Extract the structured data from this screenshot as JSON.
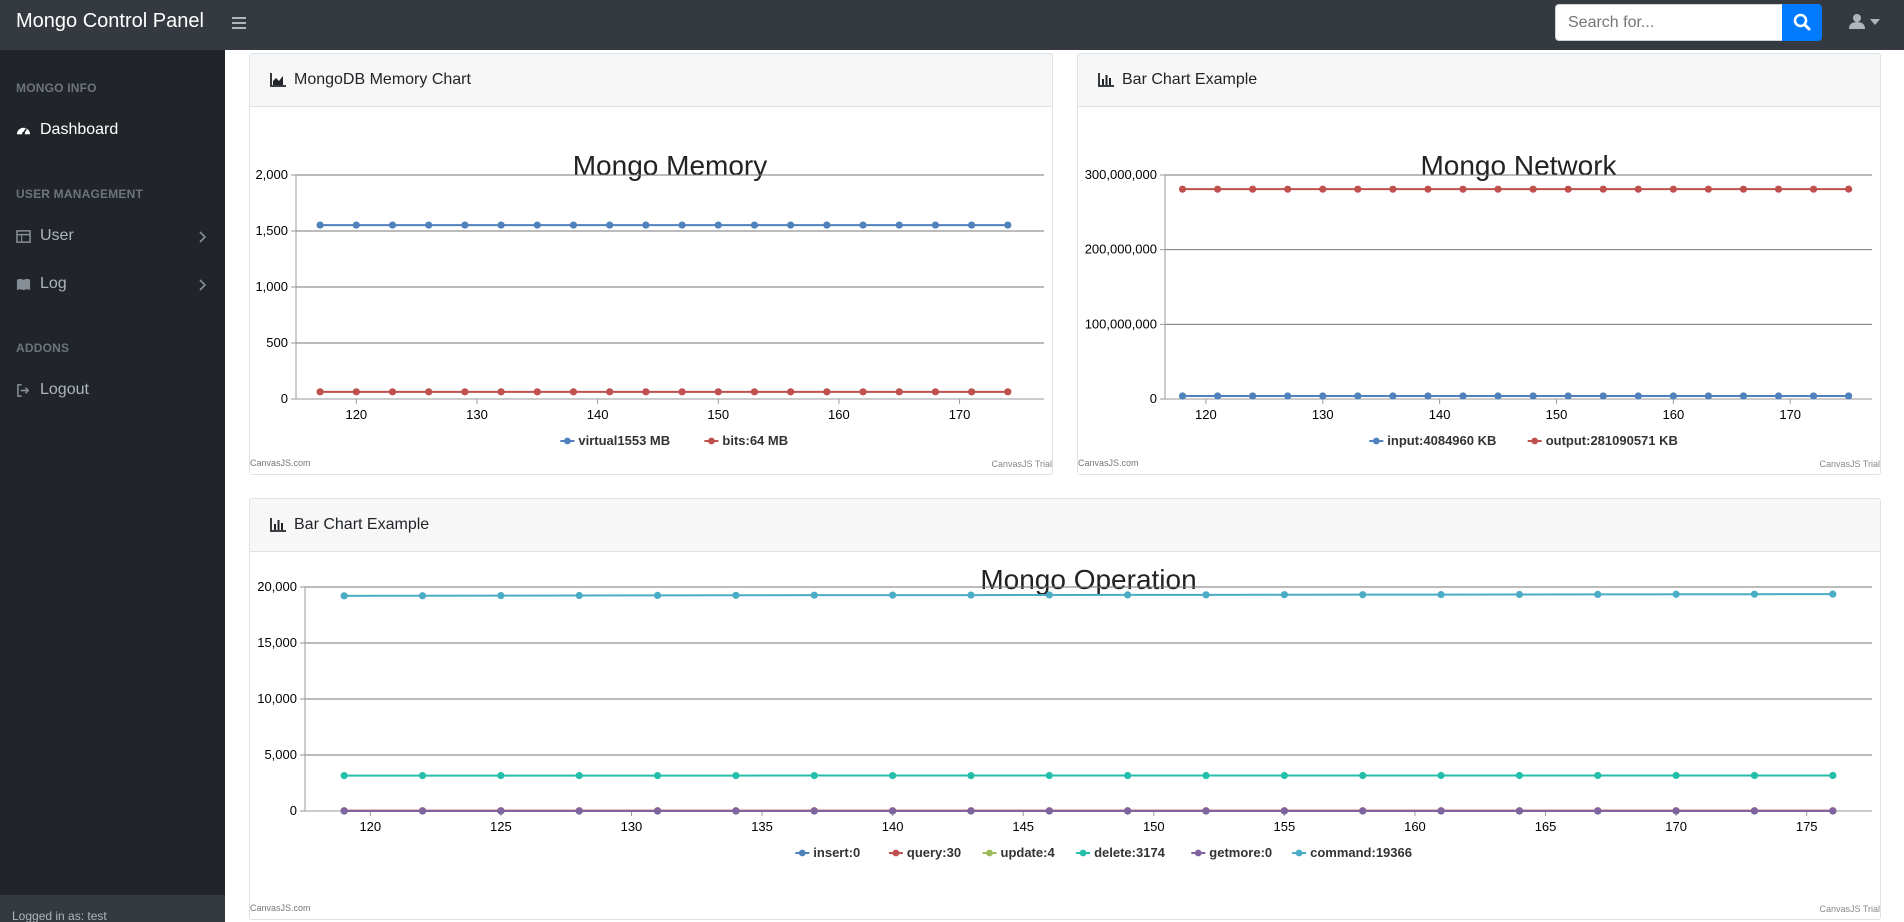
{
  "app": {
    "title": "Mongo Control Panel"
  },
  "search": {
    "placeholder": "Search for..."
  },
  "sidebar": {
    "sections": [
      {
        "heading": "MONGO INFO"
      },
      {
        "heading": "USER MANAGEMENT"
      },
      {
        "heading": "ADDONS"
      }
    ],
    "items": [
      {
        "label": "Dashboard",
        "icon": "tachometer-icon",
        "active": true
      },
      {
        "label": "User",
        "icon": "table-icon",
        "has_children": true
      },
      {
        "label": "Log",
        "icon": "book-icon",
        "has_children": true
      },
      {
        "label": "Logout",
        "icon": "sign-out-icon"
      }
    ],
    "footer": "Logged in as: test"
  },
  "cards": [
    {
      "header": "MongoDB Memory Chart",
      "icon": "area-chart-icon"
    },
    {
      "header": "Bar Chart Example",
      "icon": "bar-chart-icon"
    },
    {
      "header": "Bar Chart Example",
      "icon": "bar-chart-icon"
    }
  ],
  "credits": {
    "left": "CanvasJS.com",
    "right": "CanvasJS Trial"
  },
  "chart_data": [
    {
      "type": "line",
      "title": "Mongo Memory",
      "xlabel": "",
      "ylabel": "",
      "xlim": [
        115,
        177
      ],
      "ylim": [
        0,
        2000
      ],
      "yticks": [
        0,
        500,
        1000,
        1500,
        2000
      ],
      "xticks": [
        120,
        130,
        140,
        150,
        160,
        170
      ],
      "x": [
        117,
        120,
        123,
        126,
        129,
        132,
        135,
        138,
        141,
        144,
        147,
        150,
        153,
        156,
        159,
        162,
        165,
        168,
        171,
        174
      ],
      "series": [
        {
          "name": "virtual1553  MB",
          "color": "#4f81bc",
          "values": [
            1553,
            1553,
            1553,
            1553,
            1553,
            1553,
            1553,
            1553,
            1553,
            1553,
            1553,
            1553,
            1553,
            1553,
            1553,
            1553,
            1553,
            1553,
            1553,
            1553
          ]
        },
        {
          "name": "bits:64  MB",
          "color": "#c0504e",
          "values": [
            64,
            64,
            64,
            64,
            64,
            64,
            64,
            64,
            64,
            64,
            64,
            64,
            64,
            64,
            64,
            64,
            64,
            64,
            64,
            64
          ]
        }
      ],
      "grid": true,
      "legend": "bottom"
    },
    {
      "type": "line",
      "title": "Mongo  Network",
      "xlabel": "",
      "ylabel": "",
      "xlim": [
        116.5,
        177
      ],
      "ylim": [
        0,
        300000000
      ],
      "yticks": [
        0,
        100000000,
        200000000,
        300000000
      ],
      "xticks": [
        120,
        130,
        140,
        150,
        160,
        170
      ],
      "x": [
        118,
        121,
        124,
        127,
        130,
        133,
        136,
        139,
        142,
        145,
        148,
        151,
        154,
        157,
        160,
        163,
        166,
        169,
        172,
        175
      ],
      "series": [
        {
          "name": "input:4084960  KB",
          "color": "#4f81bc",
          "values": [
            4084960,
            4084960,
            4084960,
            4084960,
            4084960,
            4084960,
            4084960,
            4084960,
            4084960,
            4084960,
            4084960,
            4084960,
            4084960,
            4084960,
            4084960,
            4084960,
            4084960,
            4084960,
            4084960,
            4084960
          ]
        },
        {
          "name": "output:281090571  KB",
          "color": "#c0504e",
          "values": [
            281000000,
            281000000,
            281000000,
            281000000,
            281000000,
            281000000,
            281000000,
            281000000,
            281000000,
            281000000,
            281000000,
            281000000,
            281000000,
            281000000,
            281000000,
            281000000,
            281000000,
            281000000,
            281000000,
            281090571
          ]
        }
      ],
      "grid": true,
      "legend": "bottom"
    },
    {
      "type": "line",
      "title": "Mongo  Operation",
      "xlabel": "",
      "ylabel": "",
      "xlim": [
        117.5,
        177.5
      ],
      "ylim": [
        0,
        20000
      ],
      "yticks": [
        0,
        5000,
        10000,
        15000,
        20000
      ],
      "xticks": [
        120,
        125,
        130,
        135,
        140,
        145,
        150,
        155,
        160,
        165,
        170,
        175
      ],
      "x": [
        119,
        122,
        125,
        128,
        131,
        134,
        137,
        140,
        143,
        146,
        149,
        152,
        155,
        158,
        161,
        164,
        167,
        170,
        173,
        176
      ],
      "series": [
        {
          "name": "insert:0",
          "color": "#4f81bc",
          "values": [
            0,
            0,
            0,
            0,
            0,
            0,
            0,
            0,
            0,
            0,
            0,
            0,
            0,
            0,
            0,
            0,
            0,
            0,
            0,
            0
          ]
        },
        {
          "name": "query:30",
          "color": "#c0504e",
          "values": [
            30,
            30,
            30,
            30,
            30,
            30,
            30,
            30,
            30,
            30,
            30,
            30,
            30,
            30,
            30,
            30,
            30,
            30,
            30,
            30
          ]
        },
        {
          "name": "update:4",
          "color": "#9bbb58",
          "values": [
            4,
            4,
            4,
            4,
            4,
            4,
            4,
            4,
            4,
            4,
            4,
            4,
            4,
            4,
            4,
            4,
            4,
            4,
            4,
            4
          ]
        },
        {
          "name": "delete:3174",
          "color": "#23bfaa",
          "values": [
            3160,
            3161,
            3162,
            3162,
            3163,
            3164,
            3165,
            3165,
            3166,
            3167,
            3168,
            3168,
            3169,
            3170,
            3171,
            3171,
            3172,
            3173,
            3173,
            3174
          ]
        },
        {
          "name": "getmore:0",
          "color": "#8064a1",
          "values": [
            0,
            0,
            0,
            0,
            0,
            0,
            0,
            0,
            0,
            0,
            0,
            0,
            0,
            0,
            0,
            0,
            0,
            0,
            0,
            0
          ]
        },
        {
          "name": "command:19366",
          "color": "#4aacc5",
          "values": [
            19210,
            19220,
            19230,
            19240,
            19250,
            19260,
            19270,
            19275,
            19280,
            19290,
            19295,
            19300,
            19310,
            19315,
            19320,
            19330,
            19340,
            19350,
            19358,
            19366
          ]
        }
      ],
      "grid": true,
      "legend": "bottom"
    }
  ]
}
